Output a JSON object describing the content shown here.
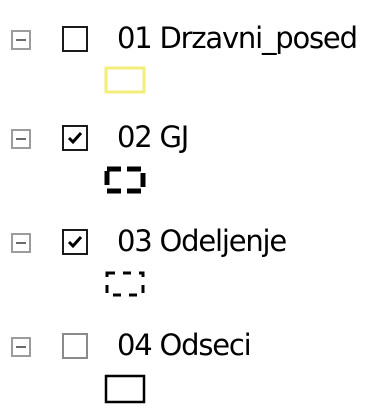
{
  "colors": {
    "poly_yellow": "#f2ee78",
    "outline_black": "#000000",
    "expander_border": "#9c9c9c",
    "checkbox_disabled": "#8a8a8a"
  },
  "layers": [
    {
      "label": "01 Drzavni_posed",
      "checked": false,
      "symbol": "yellow-outline-polygon"
    },
    {
      "label": "02 GJ",
      "checked": true,
      "symbol": "thick-dashed-polygon"
    },
    {
      "label": "03 Odeljenje",
      "checked": true,
      "symbol": "thin-dashed-polygon"
    },
    {
      "label": "04 Odseci",
      "checked": false,
      "symbol": "solid-outline-polygon"
    }
  ]
}
